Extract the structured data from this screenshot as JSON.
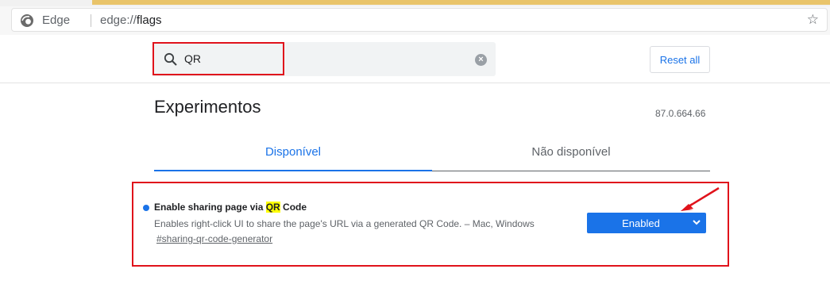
{
  "browser": {
    "name": "Edge",
    "url_prefix": "edge://",
    "url_path": "flags",
    "star_icon": "star-icon"
  },
  "search": {
    "value": "QR",
    "placeholder": "",
    "clear_icon": "×"
  },
  "header": {
    "reset_label": "Reset all"
  },
  "page": {
    "title": "Experimentos",
    "version": "87.0.664.66"
  },
  "tabs": [
    {
      "label": "Disponível",
      "active": true
    },
    {
      "label": "Não disponível",
      "active": false
    }
  ],
  "experiment": {
    "name_before": "Enable sharing page via ",
    "name_highlight": "QR",
    "name_after": " Code",
    "description": "Enables right-click UI to share the page's URL via a generated QR Code. – Mac, Windows",
    "link": "#sharing-qr-code-generator",
    "selected": "Enabled"
  },
  "colors": {
    "accent": "#1a73e8",
    "annotation": "#e0121b",
    "highlight": "#ffff00"
  }
}
